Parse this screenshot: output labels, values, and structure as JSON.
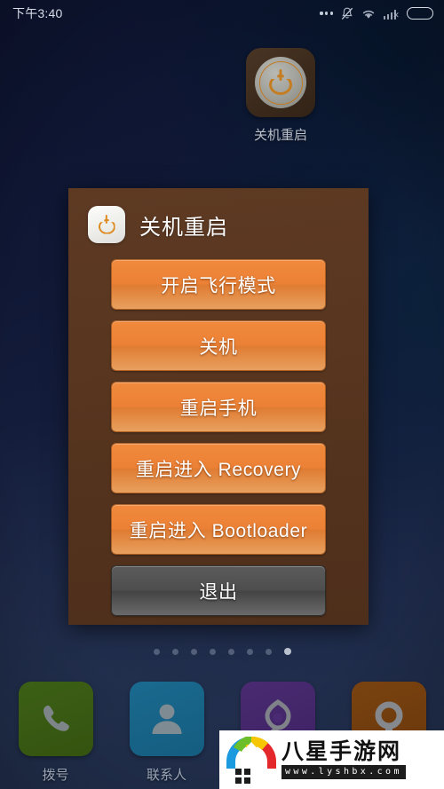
{
  "statusbar": {
    "time": "下午3:40",
    "icons": [
      {
        "name": "more-dots-icon"
      },
      {
        "name": "mute-bell-icon"
      },
      {
        "name": "wifi-icon"
      },
      {
        "name": "signal-off-icon"
      },
      {
        "name": "battery-icon"
      }
    ],
    "battery_color": "#5de327"
  },
  "home_app": {
    "label": "关机重启",
    "icon_name": "power-restart-app-icon"
  },
  "dialog": {
    "title": "关机重启",
    "icon_name": "power-icon",
    "panel_color": "#5a3722",
    "accent_color": "#ec8136",
    "buttons": [
      {
        "label": "开启飞行模式",
        "style": "orange",
        "name": "airplane-mode-button"
      },
      {
        "label": "关机",
        "style": "orange",
        "name": "power-off-button"
      },
      {
        "label": "重启手机",
        "style": "orange",
        "name": "reboot-button"
      },
      {
        "label": "重启进入 Recovery",
        "style": "orange",
        "name": "reboot-recovery-button"
      },
      {
        "label": "重启进入 Bootloader",
        "style": "orange",
        "name": "reboot-bootloader-button"
      },
      {
        "label": "退出",
        "style": "gray",
        "name": "exit-button"
      }
    ]
  },
  "page_indicator": {
    "count": 8,
    "active_index": 7
  },
  "dock": {
    "items": [
      {
        "label": "拨号",
        "icon": "phone-icon",
        "color": "#3c6016"
      },
      {
        "label": "联系人",
        "icon": "contacts-icon",
        "color": "#1a6a8f"
      },
      {
        "label": "",
        "icon": "browser-icon",
        "color": "#4a2a72"
      },
      {
        "label": "",
        "icon": "camera-icon",
        "color": "#7a4210"
      }
    ]
  },
  "watermark": {
    "title": "八星手游网",
    "url": "www.lyshbx.com",
    "logo_colors": [
      "#1b9ae0",
      "#6cbf2a",
      "#f6c700",
      "#e3272b"
    ]
  }
}
